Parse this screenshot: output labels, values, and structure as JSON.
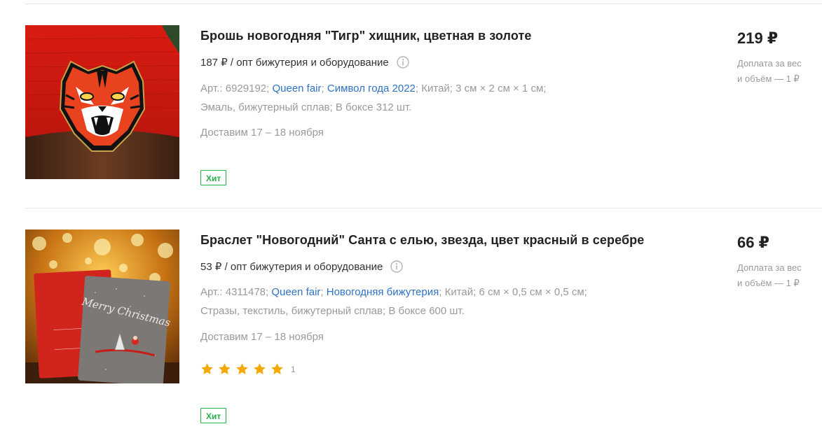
{
  "products": [
    {
      "title": "Брошь новогодняя \"Тигр\" хищник, цветная в золоте",
      "wholesale_price": "187 ₽ / опт бижутерия и оборудование",
      "article": "Арт.: 6929192;",
      "brand": "Queen fair",
      "collection": "Символ года 2022",
      "country": "Китай;",
      "size": "3 см × 2 см × 1 см;",
      "materials": "Эмаль, бижутерный сплав;",
      "box": "В боксе 312 шт.",
      "delivery": "Доставим 17 – 18 ноября",
      "badge": "Хит",
      "price": "219 ₽",
      "surcharge_line1": "Доплата за вес",
      "surcharge_line2": "и объём — 1 ₽",
      "image_icon": "tiger-brooch-image"
    },
    {
      "title": "Браслет \"Новогодний\" Санта с елью, звезда, цвет красный в серебре",
      "wholesale_price": "53 ₽ / опт бижутерия и оборудование",
      "article": "Арт.: 4311478;",
      "brand": "Queen fair",
      "collection": "Новогодняя бижутерия",
      "country": "Китай;",
      "size": "6 см × 0,5 см × 0,5 см;",
      "materials": "Стразы, текстиль, бижутерный сплав;",
      "box": "В боксе 600 шт.",
      "delivery": "Доставим 17 – 18 ноября",
      "rating_stars": 5,
      "rating_count": "1",
      "badge": "Хит",
      "price": "66 ₽",
      "surcharge_line1": "Доплата за вес",
      "surcharge_line2": "и объём — 1 ₽",
      "image_icon": "santa-bracelet-card-image",
      "card_text": "Merry Christmas"
    }
  ],
  "colors": {
    "link": "#2f72c4",
    "muted": "#9a9a9a",
    "badge_green": "#27b04a",
    "star": "#f5a800"
  }
}
